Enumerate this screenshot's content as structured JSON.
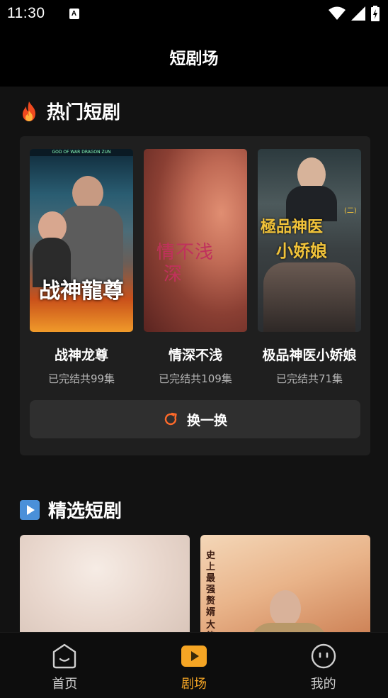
{
  "status_bar": {
    "time": "11:30",
    "a_badge": "A"
  },
  "app_bar": {
    "title": "短剧场"
  },
  "hot_section": {
    "title": "热门短剧",
    "icon": "fire-icon",
    "items": [
      {
        "name": "战神龙尊",
        "meta": "已完结共99集",
        "poster_text": "战神龍尊",
        "poster_banner": "GOD OF WAR DRAGON ZUN"
      },
      {
        "name": "情深不浅",
        "meta": "已完结共109集",
        "poster_text_1": "情不浅",
        "poster_text_2": "深"
      },
      {
        "name": "极品神医小娇娘",
        "meta": "已完结共71集",
        "poster_text_1": "極品神医",
        "poster_text_2": "小娇娘",
        "poster_tag": "(二)"
      }
    ],
    "refresh_label": "换一换"
  },
  "featured_section": {
    "title": "精选短剧",
    "icon": "play-square-icon",
    "poster_text": "史上最强赘婿",
    "poster_text_2": "大律"
  },
  "bottom_nav": {
    "items": [
      {
        "label": "首页",
        "icon": "home-face-icon",
        "active": false
      },
      {
        "label": "剧场",
        "icon": "play-icon",
        "active": true
      },
      {
        "label": "我的",
        "icon": "profile-face-icon",
        "active": false
      }
    ]
  },
  "colors": {
    "accent": "#f5a524",
    "refresh_icon": "#ff6a2a",
    "card_bg": "#1f1f1f"
  }
}
